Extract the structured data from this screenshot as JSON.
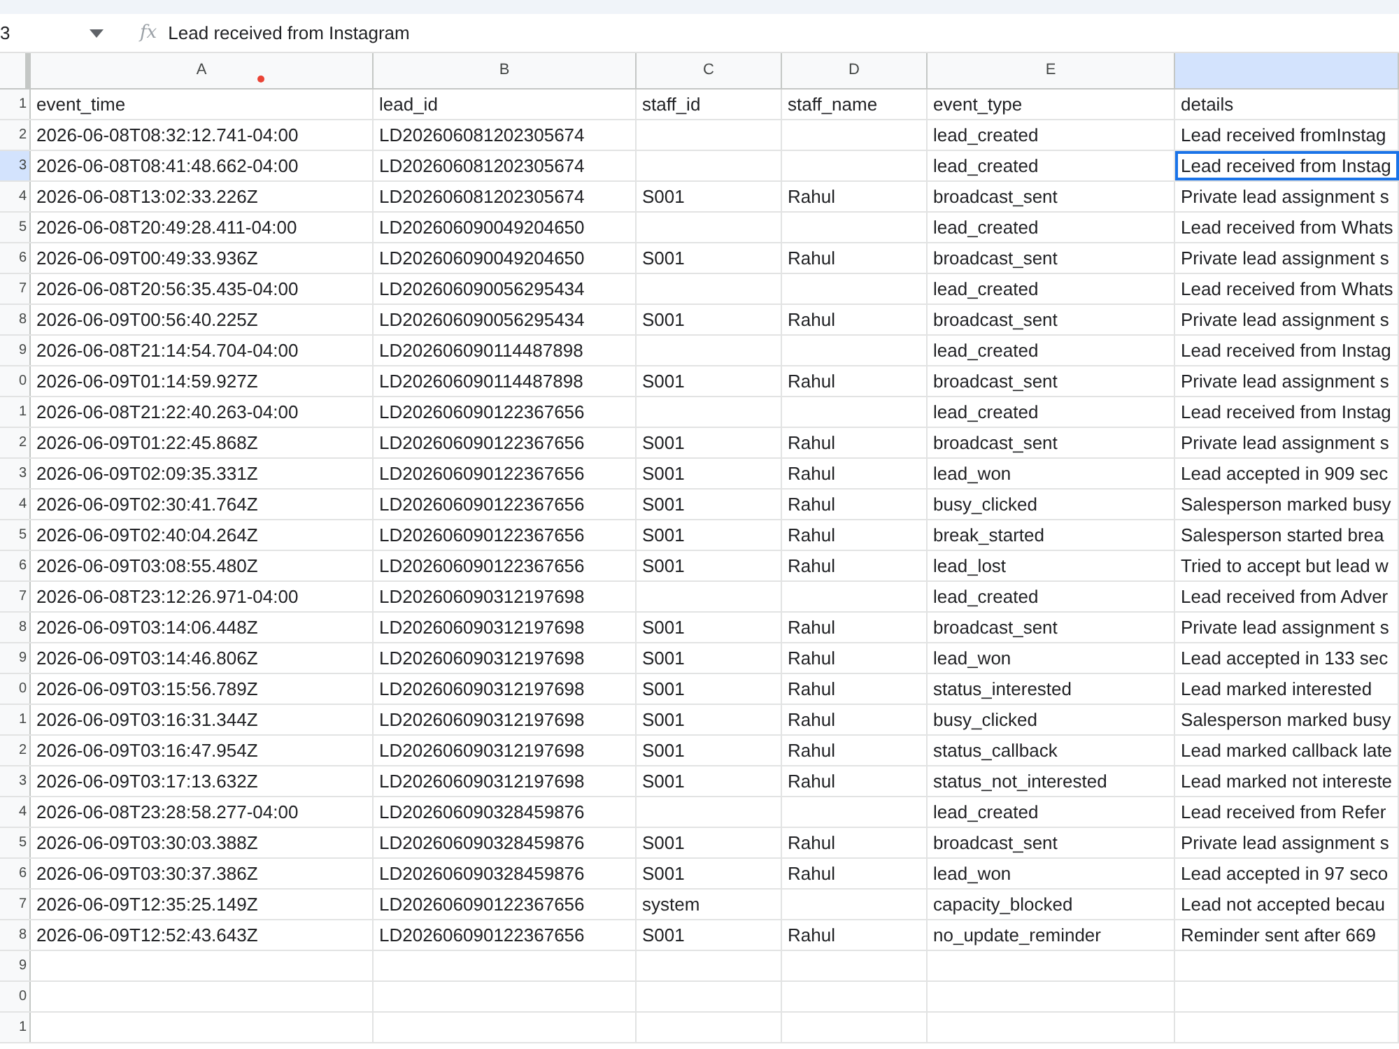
{
  "formula_bar": {
    "cell_ref": "3",
    "fx_label": "fx",
    "formula": "Lead received from Instagram"
  },
  "columns": [
    {
      "letter": "A",
      "selected": false,
      "notification": true
    },
    {
      "letter": "B",
      "selected": false,
      "notification": false
    },
    {
      "letter": "C",
      "selected": false,
      "notification": false
    },
    {
      "letter": "D",
      "selected": false,
      "notification": false
    },
    {
      "letter": "E",
      "selected": false,
      "notification": false
    },
    {
      "selected": true,
      "notification": false
    }
  ],
  "rows": [
    {
      "number": "1",
      "selected": false,
      "cells": [
        "event_time",
        "lead_id",
        "staff_id",
        "staff_name",
        "event_type",
        "details"
      ]
    },
    {
      "number": "2",
      "selected": false,
      "cells": [
        "2026-06-08T08:32:12.741-04:00",
        "LD202606081202305674",
        "",
        "",
        "lead_created",
        "Lead received fromInstag"
      ]
    },
    {
      "number": "3",
      "selected": true,
      "cells": [
        "2026-06-08T08:41:48.662-04:00",
        "LD202606081202305674",
        "",
        "",
        "lead_created",
        "Lead received from Instag"
      ]
    },
    {
      "number": "4",
      "selected": false,
      "cells": [
        "2026-06-08T13:02:33.226Z",
        "LD202606081202305674",
        "S001",
        "Rahul",
        "broadcast_sent",
        "Private lead assignment s"
      ]
    },
    {
      "number": "5",
      "selected": false,
      "cells": [
        "2026-06-08T20:49:28.411-04:00",
        "LD202606090049204650",
        "",
        "",
        "lead_created",
        "Lead received from Whats"
      ]
    },
    {
      "number": "6",
      "selected": false,
      "cells": [
        "2026-06-09T00:49:33.936Z",
        "LD202606090049204650",
        "S001",
        "Rahul",
        "broadcast_sent",
        "Private lead assignment s"
      ]
    },
    {
      "number": "7",
      "selected": false,
      "cells": [
        "2026-06-08T20:56:35.435-04:00",
        "LD202606090056295434",
        "",
        "",
        "lead_created",
        "Lead received from Whats"
      ]
    },
    {
      "number": "8",
      "selected": false,
      "cells": [
        "2026-06-09T00:56:40.225Z",
        "LD202606090056295434",
        "S001",
        "Rahul",
        "broadcast_sent",
        "Private lead assignment s"
      ]
    },
    {
      "number": "9",
      "selected": false,
      "cells": [
        "2026-06-08T21:14:54.704-04:00",
        "LD202606090114487898",
        "",
        "",
        "lead_created",
        "Lead received from Instag"
      ]
    },
    {
      "number": "0",
      "selected": false,
      "cells": [
        "2026-06-09T01:14:59.927Z",
        "LD202606090114487898",
        "S001",
        "Rahul",
        "broadcast_sent",
        "Private lead assignment s"
      ]
    },
    {
      "number": "1",
      "selected": false,
      "cells": [
        "2026-06-08T21:22:40.263-04:00",
        "LD202606090122367656",
        "",
        "",
        "lead_created",
        "Lead received from Instag"
      ]
    },
    {
      "number": "2",
      "selected": false,
      "cells": [
        "2026-06-09T01:22:45.868Z",
        "LD202606090122367656",
        "S001",
        "Rahul",
        "broadcast_sent",
        "Private lead assignment s"
      ]
    },
    {
      "number": "3",
      "selected": false,
      "cells": [
        "2026-06-09T02:09:35.331Z",
        "LD202606090122367656",
        "S001",
        "Rahul",
        "lead_won",
        "Lead accepted in 909 sec"
      ]
    },
    {
      "number": "4",
      "selected": false,
      "cells": [
        "2026-06-09T02:30:41.764Z",
        "LD202606090122367656",
        "S001",
        "Rahul",
        "busy_clicked",
        "Salesperson marked busy"
      ]
    },
    {
      "number": "5",
      "selected": false,
      "cells": [
        "2026-06-09T02:40:04.264Z",
        "LD202606090122367656",
        "S001",
        "Rahul",
        "break_started",
        "Salesperson started brea"
      ]
    },
    {
      "number": "6",
      "selected": false,
      "cells": [
        "2026-06-09T03:08:55.480Z",
        "LD202606090122367656",
        "S001",
        "Rahul",
        "lead_lost",
        "Tried to accept but lead w"
      ]
    },
    {
      "number": "7",
      "selected": false,
      "cells": [
        "2026-06-08T23:12:26.971-04:00",
        "LD202606090312197698",
        "",
        "",
        "lead_created",
        "Lead received from Adver"
      ]
    },
    {
      "number": "8",
      "selected": false,
      "cells": [
        "2026-06-09T03:14:06.448Z",
        "LD202606090312197698",
        "S001",
        "Rahul",
        "broadcast_sent",
        "Private lead assignment s"
      ]
    },
    {
      "number": "9",
      "selected": false,
      "cells": [
        "2026-06-09T03:14:46.806Z",
        "LD202606090312197698",
        "S001",
        "Rahul",
        "lead_won",
        "Lead accepted in 133 sec"
      ]
    },
    {
      "number": "0",
      "selected": false,
      "cells": [
        "2026-06-09T03:15:56.789Z",
        "LD202606090312197698",
        "S001",
        "Rahul",
        "status_interested",
        "Lead marked interested"
      ]
    },
    {
      "number": "1",
      "selected": false,
      "cells": [
        "2026-06-09T03:16:31.344Z",
        "LD202606090312197698",
        "S001",
        "Rahul",
        "busy_clicked",
        "Salesperson marked busy"
      ]
    },
    {
      "number": "2",
      "selected": false,
      "cells": [
        "2026-06-09T03:16:47.954Z",
        "LD202606090312197698",
        "S001",
        "Rahul",
        "status_callback",
        "Lead marked callback late"
      ]
    },
    {
      "number": "3",
      "selected": false,
      "cells": [
        "2026-06-09T03:17:13.632Z",
        "LD202606090312197698",
        "S001",
        "Rahul",
        "status_not_interested",
        "Lead marked not intereste"
      ]
    },
    {
      "number": "4",
      "selected": false,
      "cells": [
        "2026-06-08T23:28:58.277-04:00",
        "LD202606090328459876",
        "",
        "",
        "lead_created",
        "Lead received from Refer"
      ]
    },
    {
      "number": "5",
      "selected": false,
      "cells": [
        "2026-06-09T03:30:03.388Z",
        "LD202606090328459876",
        "S001",
        "Rahul",
        "broadcast_sent",
        "Private lead assignment s"
      ]
    },
    {
      "number": "6",
      "selected": false,
      "cells": [
        "2026-06-09T03:30:37.386Z",
        "LD202606090328459876",
        "S001",
        "Rahul",
        "lead_won",
        "Lead accepted in 97 seco"
      ]
    },
    {
      "number": "7",
      "selected": false,
      "cells": [
        "2026-06-09T12:35:25.149Z",
        "LD202606090122367656",
        "system",
        "",
        "capacity_blocked",
        "Lead not accepted becau"
      ]
    },
    {
      "number": "8",
      "selected": false,
      "cells": [
        "2026-06-09T12:52:43.643Z",
        "LD202606090122367656",
        "S001",
        "Rahul",
        "no_update_reminder",
        "Reminder sent after 669"
      ]
    },
    {
      "number": "9",
      "selected": false,
      "cells": [
        "",
        "",
        "",
        "",
        "",
        ""
      ]
    },
    {
      "number": "0",
      "selected": false,
      "cells": [
        "",
        "",
        "",
        "",
        "",
        ""
      ]
    },
    {
      "number": "1",
      "selected": false,
      "cells": [
        "",
        "",
        "",
        "",
        "",
        ""
      ]
    }
  ]
}
